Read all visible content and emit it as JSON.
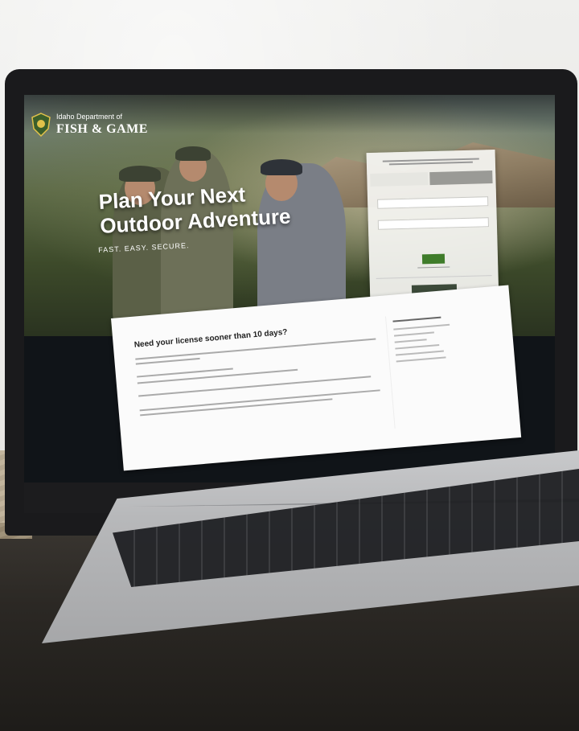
{
  "brand": {
    "small": "Idaho Department of",
    "large": "FISH & GAME"
  },
  "hero": {
    "title_line1": "Plan Your Next",
    "title_line2": "Outdoor Adventure",
    "subtitle": "FAST. EASY. SECURE."
  },
  "content": {
    "title": "Need your license sooner than 10 days?"
  },
  "colors": {
    "login_button": "#3f7c2a",
    "dark_button": "#3c4a39"
  }
}
